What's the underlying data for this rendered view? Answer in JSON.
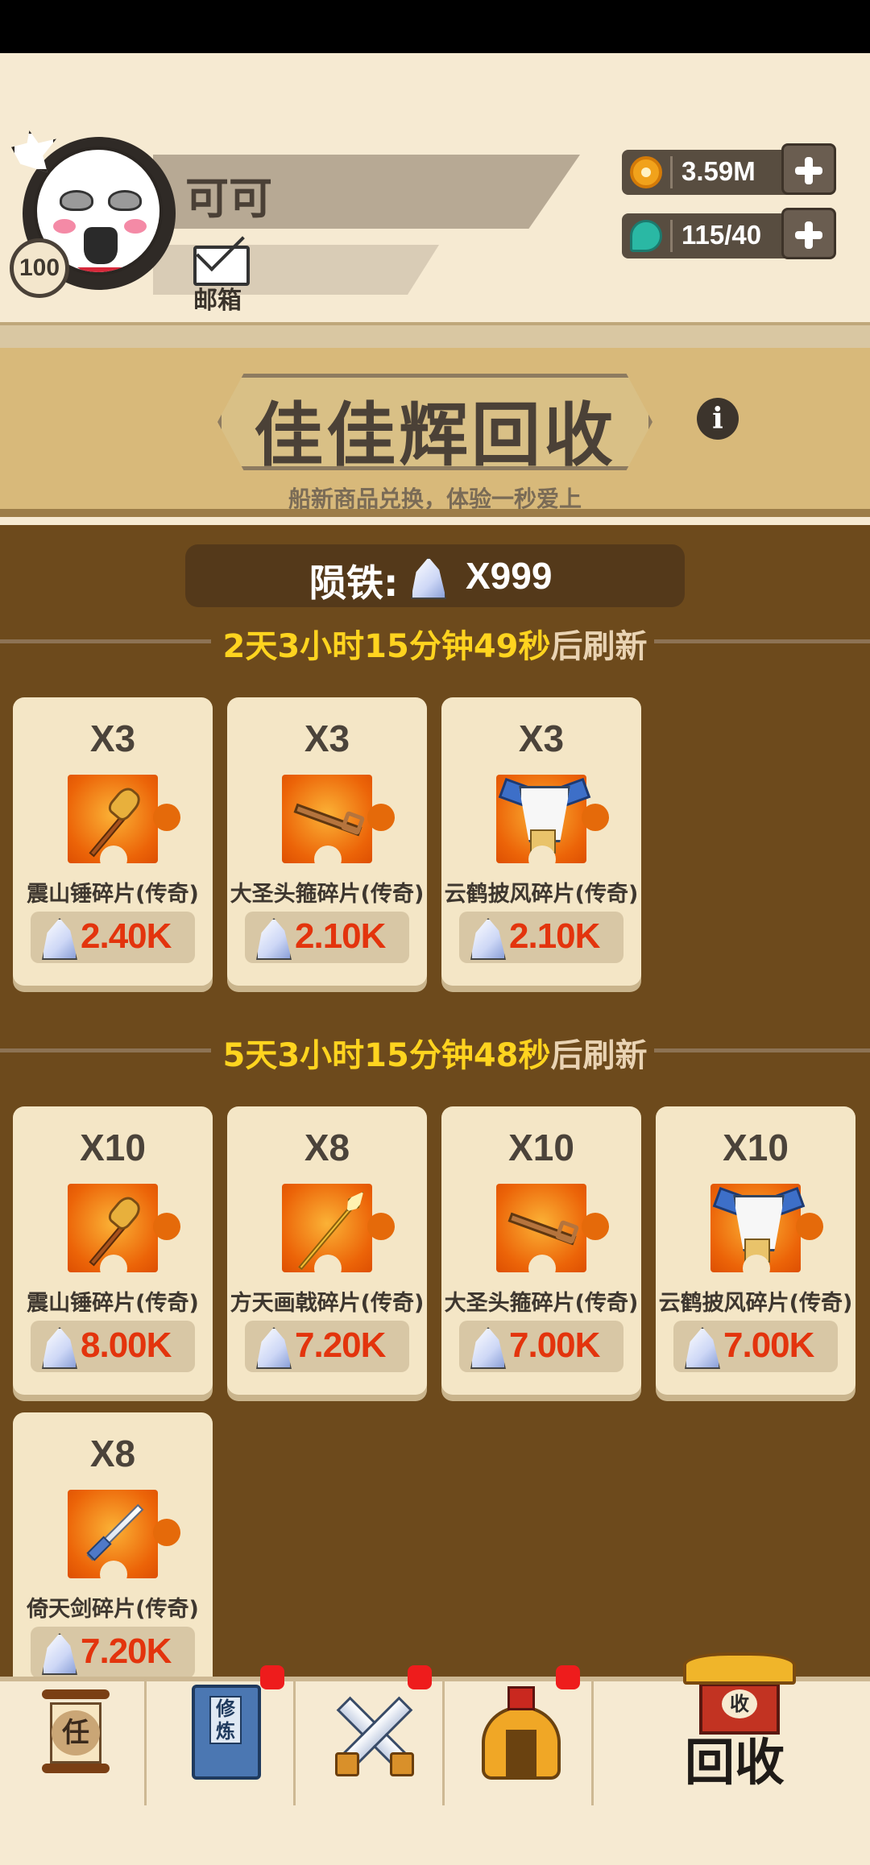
{
  "profile": {
    "name": "可可",
    "level": "100",
    "mail_label": "邮箱"
  },
  "currency": {
    "coins": "3.59M",
    "gems": "115/40"
  },
  "shop": {
    "title": "佳佳辉回收",
    "subtitle": "船新商品兑换，体验一秒爱上",
    "balance_label": "陨铁:",
    "balance_value": "X999"
  },
  "sections": [
    {
      "refresh_time": "2天3小时15分钟49秒",
      "refresh_suffix": "后刷新",
      "items": [
        {
          "qty": "X3",
          "name": "震山锤碎片(传奇)",
          "price": "2.40K",
          "icon": "hammer-icon"
        },
        {
          "qty": "X3",
          "name": "大圣头箍碎片(传奇)",
          "price": "2.10K",
          "icon": "headband-key-icon"
        },
        {
          "qty": "X3",
          "name": "云鹤披风碎片(传奇)",
          "price": "2.10K",
          "icon": "cape-robe-icon"
        }
      ]
    },
    {
      "refresh_time": "5天3小时15分钟48秒",
      "refresh_suffix": "后刷新",
      "items": [
        {
          "qty": "X10",
          "name": "震山锤碎片(传奇)",
          "price": "8.00K",
          "icon": "hammer-icon"
        },
        {
          "qty": "X8",
          "name": "方天画戟碎片(传奇)",
          "price": "7.20K",
          "icon": "halberd-icon"
        },
        {
          "qty": "X10",
          "name": "大圣头箍碎片(传奇)",
          "price": "7.00K",
          "icon": "headband-key-icon"
        },
        {
          "qty": "X10",
          "name": "云鹤披风碎片(传奇)",
          "price": "7.00K",
          "icon": "cape-robe-icon"
        },
        {
          "qty": "X8",
          "name": "倚天剑碎片(传奇)",
          "price": "7.20K",
          "icon": "sword-icon"
        }
      ]
    }
  ],
  "tabs": {
    "task_char": "任",
    "cultivate_label": "修炼",
    "recycle_sign": "收",
    "recycle_label": "回收"
  },
  "colors": {
    "price": "#e3340d",
    "refresh_time": "#ffd41f",
    "shop_bg": "#6d4a1c",
    "badge": "#ee1c1c"
  }
}
